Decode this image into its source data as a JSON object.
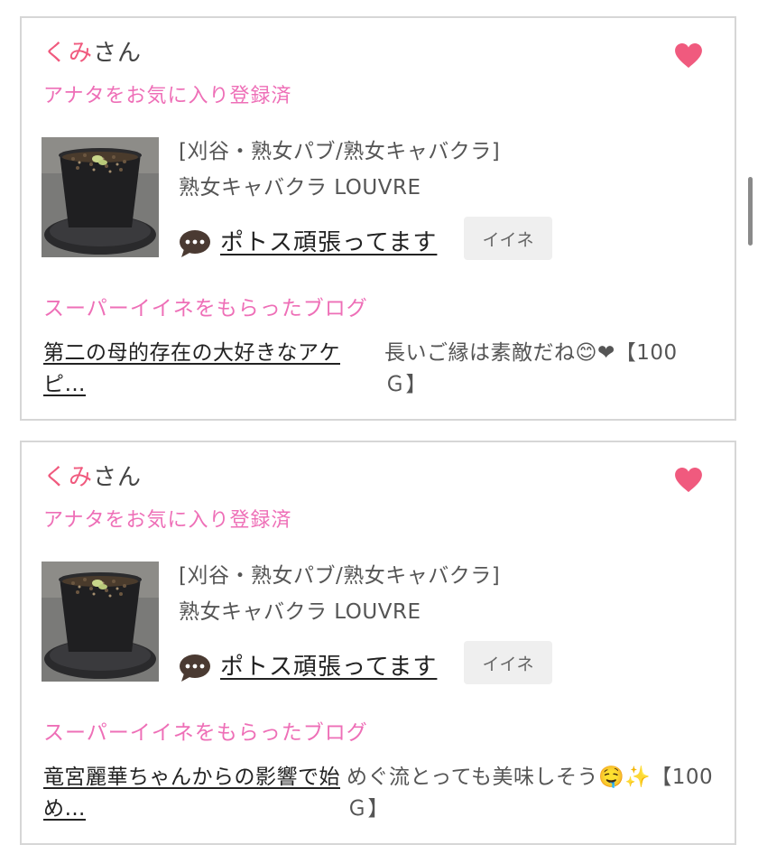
{
  "cards": [
    {
      "user_name_pink": "くみ",
      "user_name_rest": "さん",
      "favorite_status": "アナタをお気に入り登録済",
      "shop_category": "[刈谷・熟女パブ/熟女キャバクラ]",
      "shop_name": "熟女キャバクラ LOUVRE",
      "post_title": "ポトス頑張ってます",
      "iine_label": "イイネ",
      "section_heading": "スーパーイイネをもらったブログ",
      "blog_title": "第二の母的存在の大好きなアケピ…",
      "comment": "長いご縁は素敵だね😊❤【100Ｇ】"
    },
    {
      "user_name_pink": "くみ",
      "user_name_rest": "さん",
      "favorite_status": "アナタをお気に入り登録済",
      "shop_category": "[刈谷・熟女パブ/熟女キャバクラ]",
      "shop_name": "熟女キャバクラ LOUVRE",
      "post_title": "ポトス頑張ってます",
      "iine_label": "イイネ",
      "section_heading": "スーパーイイネをもらったブログ",
      "blog_title": "竜宮麗華ちゃんからの影響で始め…",
      "comment": "めぐ流とっても美味しそう🤤✨【100Ｇ】"
    }
  ],
  "colors": {
    "accent_pink": "#ee6fb7",
    "name_pink": "#f05a7e",
    "heart": "#f05a7e",
    "card_border": "#d6d6d6"
  },
  "icons": {
    "favorite": "heart-icon",
    "comment": "chat-bubble-icon"
  }
}
